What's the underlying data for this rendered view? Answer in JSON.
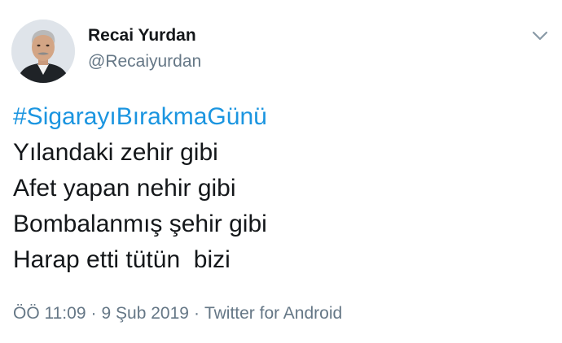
{
  "author": {
    "display_name": "Recai Yurdan",
    "handle": "@Recaiyurdan"
  },
  "menu_icon": "chevron-down-icon",
  "tweet": {
    "hashtag": "#SigarayıBırakmaGünü",
    "lines": [
      "Yılandaki zehir gibi",
      "Afet yapan nehir gibi",
      "Bombalanmış şehir gibi",
      "Harap etti tütün  bizi"
    ]
  },
  "meta": {
    "time": "ÖÖ 11:09",
    "separator": "·",
    "date": "9 Şub 2019",
    "source": "Twitter for Android"
  },
  "colors": {
    "link": "#1b95e0",
    "secondary_text": "#657786",
    "primary_text": "#14171a"
  }
}
